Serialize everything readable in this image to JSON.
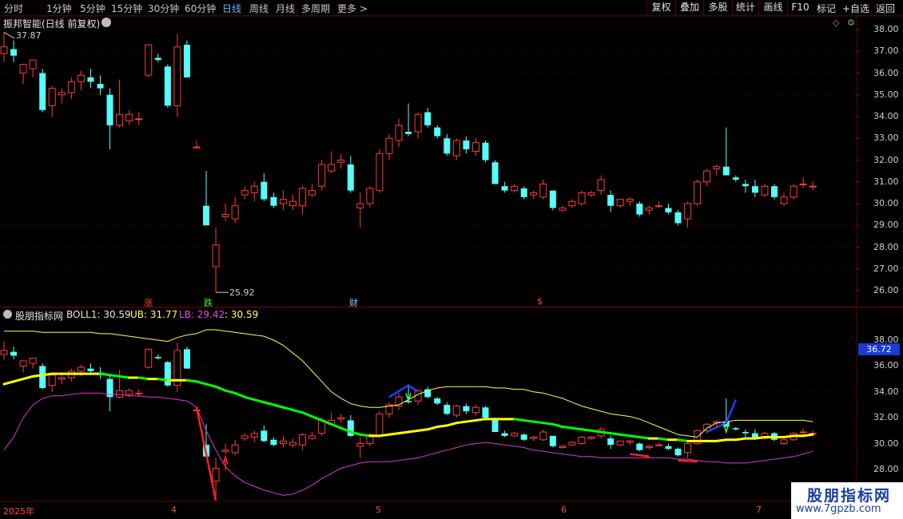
{
  "toolbar": {
    "periods": [
      "分时",
      "1分钟",
      "5分钟",
      "15分钟",
      "30分钟",
      "60分钟",
      "日线",
      "周线",
      "月线",
      "多周期",
      "更多 >"
    ],
    "actions": [
      "复权",
      "叠加",
      "多股",
      "统计",
      "画线",
      "F10",
      "+自选",
      "返回"
    ]
  },
  "main_chart": {
    "title": "振邦智能(日线 前复权)",
    "high_label": "37.87",
    "low_label": "25.92",
    "y_ticks": [
      "38.00",
      "37.00",
      "36.00",
      "35.00",
      "34.00",
      "33.00",
      "32.00",
      "31.00",
      "30.00",
      "29.00",
      "28.00",
      "27.00",
      "26.00"
    ],
    "markers": [
      "涨",
      "跌",
      "财",
      "$"
    ]
  },
  "indicator": {
    "name": "股朋指标网",
    "boll1_label": "BOLL1: 30.59",
    "ub_label": "UB: 31.77",
    "lb_label": "LB: 29.42",
    "extra_label": ": 30.59",
    "y_ticks": [
      "38.00",
      "36.00",
      "34.00",
      "32.00",
      "30.00",
      "28.00"
    ],
    "price_tag": "36.72"
  },
  "x_axis": {
    "labels": [
      "2025年",
      "4",
      "5",
      "6",
      "7"
    ]
  },
  "watermark": {
    "name": "股朋指标网",
    "url": "www.7gpzb.com"
  },
  "colors": {
    "up": "#ff3b3b",
    "down": "#54ffff",
    "upper_band": "#ffff55",
    "lower_band": "#d63ad6",
    "mid_up": "#ffff00",
    "mid_down": "#00ff00",
    "grid": "#5a0000"
  },
  "chart_data": {
    "type": "candlestick",
    "note_units": "price",
    "candles": [
      {
        "o": 36.9,
        "h": 37.87,
        "l": 36.5,
        "c": 37.2
      },
      {
        "o": 37.1,
        "h": 37.5,
        "l": 36.5,
        "c": 36.8
      },
      {
        "o": 36.0,
        "h": 36.4,
        "l": 35.5,
        "c": 36.4
      },
      {
        "o": 36.2,
        "h": 36.6,
        "l": 35.8,
        "c": 36.6
      },
      {
        "o": 36.0,
        "h": 36.2,
        "l": 34.2,
        "c": 34.3
      },
      {
        "o": 34.5,
        "h": 35.4,
        "l": 34.0,
        "c": 35.3
      },
      {
        "o": 35.0,
        "h": 35.3,
        "l": 34.6,
        "c": 35.1
      },
      {
        "o": 35.1,
        "h": 35.8,
        "l": 34.8,
        "c": 35.6
      },
      {
        "o": 35.6,
        "h": 36.1,
        "l": 35.2,
        "c": 35.9
      },
      {
        "o": 35.8,
        "h": 36.2,
        "l": 35.3,
        "c": 35.6
      },
      {
        "o": 35.5,
        "h": 35.9,
        "l": 35.0,
        "c": 35.3
      },
      {
        "o": 35.0,
        "h": 35.3,
        "l": 32.5,
        "c": 33.6
      },
      {
        "o": 33.6,
        "h": 35.7,
        "l": 33.5,
        "c": 34.1
      },
      {
        "o": 33.8,
        "h": 34.3,
        "l": 33.6,
        "c": 34.1
      },
      {
        "o": 33.9,
        "h": 34.2,
        "l": 33.6,
        "c": 33.9
      },
      {
        "o": 35.9,
        "h": 37.3,
        "l": 35.8,
        "c": 37.3
      },
      {
        "o": 36.7,
        "h": 36.9,
        "l": 36.5,
        "c": 36.6
      },
      {
        "o": 36.3,
        "h": 36.4,
        "l": 34.4,
        "c": 34.5
      },
      {
        "o": 34.5,
        "h": 37.8,
        "l": 34.0,
        "c": 37.2
      },
      {
        "o": 37.3,
        "h": 37.5,
        "l": 35.8,
        "c": 35.8
      },
      {
        "o": 32.6,
        "h": 32.9,
        "l": 32.6,
        "c": 32.6
      },
      {
        "o": 29.9,
        "h": 31.5,
        "l": 29.0,
        "c": 29.0
      },
      {
        "o": 27.1,
        "h": 28.9,
        "l": 25.92,
        "c": 28.1
      },
      {
        "o": 29.4,
        "h": 30.0,
        "l": 29.2,
        "c": 29.5
      },
      {
        "o": 29.3,
        "h": 30.3,
        "l": 29.1,
        "c": 29.9
      },
      {
        "o": 30.4,
        "h": 30.8,
        "l": 30.2,
        "c": 30.6
      },
      {
        "o": 30.5,
        "h": 31.0,
        "l": 30.1,
        "c": 30.8
      },
      {
        "o": 31.0,
        "h": 31.4,
        "l": 30.1,
        "c": 30.2
      },
      {
        "o": 30.3,
        "h": 30.5,
        "l": 29.8,
        "c": 29.9
      },
      {
        "o": 30.0,
        "h": 30.6,
        "l": 29.7,
        "c": 30.2
      },
      {
        "o": 29.9,
        "h": 30.4,
        "l": 29.7,
        "c": 30.1
      },
      {
        "o": 29.9,
        "h": 30.8,
        "l": 29.5,
        "c": 30.7
      },
      {
        "o": 30.4,
        "h": 30.9,
        "l": 30.3,
        "c": 30.6
      },
      {
        "o": 30.8,
        "h": 32.0,
        "l": 30.6,
        "c": 31.8
      },
      {
        "o": 31.5,
        "h": 32.4,
        "l": 31.4,
        "c": 31.8
      },
      {
        "o": 31.9,
        "h": 32.3,
        "l": 31.6,
        "c": 32.0
      },
      {
        "o": 31.8,
        "h": 32.2,
        "l": 30.5,
        "c": 30.6
      },
      {
        "o": 29.8,
        "h": 30.5,
        "l": 28.9,
        "c": 30.0
      },
      {
        "o": 30.0,
        "h": 30.8,
        "l": 29.8,
        "c": 30.7
      },
      {
        "o": 30.6,
        "h": 32.5,
        "l": 30.5,
        "c": 32.3
      },
      {
        "o": 32.3,
        "h": 33.2,
        "l": 32.0,
        "c": 33.0
      },
      {
        "o": 32.9,
        "h": 33.9,
        "l": 32.6,
        "c": 33.6
      },
      {
        "o": 33.3,
        "h": 34.6,
        "l": 33.1,
        "c": 33.2
      },
      {
        "o": 33.3,
        "h": 34.2,
        "l": 33.0,
        "c": 34.1
      },
      {
        "o": 34.2,
        "h": 34.4,
        "l": 33.5,
        "c": 33.6
      },
      {
        "o": 33.5,
        "h": 33.6,
        "l": 33.0,
        "c": 33.1
      },
      {
        "o": 33.0,
        "h": 33.2,
        "l": 32.2,
        "c": 32.3
      },
      {
        "o": 32.2,
        "h": 33.0,
        "l": 32.0,
        "c": 32.9
      },
      {
        "o": 32.9,
        "h": 33.1,
        "l": 32.3,
        "c": 32.5
      },
      {
        "o": 32.4,
        "h": 33.0,
        "l": 32.2,
        "c": 32.8
      },
      {
        "o": 32.8,
        "h": 32.9,
        "l": 31.9,
        "c": 32.0
      },
      {
        "o": 31.9,
        "h": 32.0,
        "l": 30.9,
        "c": 30.9
      },
      {
        "o": 30.8,
        "h": 31.0,
        "l": 30.5,
        "c": 30.6
      },
      {
        "o": 30.6,
        "h": 30.9,
        "l": 30.5,
        "c": 30.8
      },
      {
        "o": 30.7,
        "h": 30.8,
        "l": 30.2,
        "c": 30.3
      },
      {
        "o": 30.4,
        "h": 30.6,
        "l": 30.2,
        "c": 30.5
      },
      {
        "o": 30.3,
        "h": 31.1,
        "l": 30.2,
        "c": 30.9
      },
      {
        "o": 30.6,
        "h": 30.6,
        "l": 29.7,
        "c": 29.8
      },
      {
        "o": 29.7,
        "h": 29.9,
        "l": 29.6,
        "c": 29.8
      },
      {
        "o": 29.9,
        "h": 30.2,
        "l": 29.8,
        "c": 30.1
      },
      {
        "o": 30.0,
        "h": 30.6,
        "l": 29.9,
        "c": 30.5
      },
      {
        "o": 30.4,
        "h": 30.6,
        "l": 30.3,
        "c": 30.5
      },
      {
        "o": 30.6,
        "h": 31.3,
        "l": 30.4,
        "c": 31.1
      },
      {
        "o": 30.4,
        "h": 30.6,
        "l": 29.6,
        "c": 29.9
      },
      {
        "o": 29.9,
        "h": 30.2,
        "l": 29.8,
        "c": 30.2
      },
      {
        "o": 30.1,
        "h": 30.3,
        "l": 29.9,
        "c": 30.2
      },
      {
        "o": 30.0,
        "h": 30.1,
        "l": 29.4,
        "c": 29.5
      },
      {
        "o": 29.7,
        "h": 29.9,
        "l": 29.5,
        "c": 29.8
      },
      {
        "o": 29.9,
        "h": 30.1,
        "l": 29.8,
        "c": 29.9
      },
      {
        "o": 29.8,
        "h": 30.0,
        "l": 29.5,
        "c": 29.6
      },
      {
        "o": 29.6,
        "h": 29.7,
        "l": 29.0,
        "c": 29.1
      },
      {
        "o": 29.3,
        "h": 30.1,
        "l": 28.9,
        "c": 30.0
      },
      {
        "o": 30.0,
        "h": 31.1,
        "l": 29.9,
        "c": 31.0
      },
      {
        "o": 31.0,
        "h": 31.6,
        "l": 30.8,
        "c": 31.5
      },
      {
        "o": 31.6,
        "h": 31.8,
        "l": 31.3,
        "c": 31.7
      },
      {
        "o": 31.7,
        "h": 33.5,
        "l": 31.3,
        "c": 31.3
      },
      {
        "o": 31.2,
        "h": 31.3,
        "l": 31.0,
        "c": 31.1
      },
      {
        "o": 30.9,
        "h": 31.1,
        "l": 30.5,
        "c": 30.8
      },
      {
        "o": 30.8,
        "h": 31.1,
        "l": 30.3,
        "c": 30.5
      },
      {
        "o": 30.4,
        "h": 30.9,
        "l": 30.3,
        "c": 30.8
      },
      {
        "o": 30.8,
        "h": 30.9,
        "l": 30.2,
        "c": 30.3
      },
      {
        "o": 30.0,
        "h": 30.5,
        "l": 29.9,
        "c": 30.3
      },
      {
        "o": 30.3,
        "h": 30.9,
        "l": 30.2,
        "c": 30.8
      },
      {
        "o": 30.9,
        "h": 31.2,
        "l": 30.7,
        "c": 30.9
      },
      {
        "o": 30.8,
        "h": 31.0,
        "l": 30.6,
        "c": 30.8
      }
    ],
    "boll_mid": [
      34.6,
      34.8,
      35.0,
      35.2,
      35.3,
      35.4,
      35.4,
      35.4,
      35.4,
      35.4,
      35.4,
      35.3,
      35.2,
      35.1,
      35.1,
      35.0,
      35.0,
      34.9,
      34.9,
      34.9,
      34.8,
      34.6,
      34.4,
      34.1,
      33.9,
      33.6,
      33.4,
      33.2,
      33.0,
      32.8,
      32.6,
      32.4,
      32.1,
      31.8,
      31.5,
      31.2,
      30.9,
      30.7,
      30.6,
      30.6,
      30.7,
      30.8,
      30.9,
      31.0,
      31.1,
      31.3,
      31.4,
      31.6,
      31.7,
      31.8,
      31.9,
      31.9,
      31.9,
      31.9,
      31.8,
      31.7,
      31.6,
      31.5,
      31.3,
      31.2,
      31.1,
      31.0,
      30.9,
      30.8,
      30.7,
      30.6,
      30.5,
      30.4,
      30.4,
      30.3,
      30.3,
      30.2,
      30.2,
      30.2,
      30.2,
      30.3,
      30.3,
      30.4,
      30.4,
      30.5,
      30.5,
      30.5,
      30.6,
      30.6,
      30.7
    ],
    "boll_upper": [
      38.7,
      38.7,
      38.7,
      38.7,
      38.6,
      38.6,
      38.6,
      38.6,
      38.6,
      38.6,
      38.5,
      38.5,
      38.4,
      38.3,
      38.2,
      38.1,
      38.0,
      37.9,
      38.2,
      38.4,
      38.5,
      38.8,
      38.8,
      38.7,
      38.6,
      38.5,
      38.4,
      38.3,
      38.0,
      37.6,
      37.0,
      36.4,
      35.6,
      34.8,
      34.0,
      33.5,
      33.1,
      32.9,
      32.8,
      32.8,
      32.9,
      33.0,
      33.4,
      33.8,
      34.1,
      34.3,
      34.4,
      34.4,
      34.4,
      34.4,
      34.4,
      34.3,
      34.3,
      34.2,
      34.2,
      34.0,
      33.9,
      33.7,
      33.5,
      33.2,
      32.9,
      32.7,
      32.5,
      32.3,
      32.2,
      32.1,
      31.9,
      31.6,
      31.3,
      31.0,
      30.7,
      30.6,
      30.5,
      31.2,
      31.6,
      31.7,
      31.8,
      31.8,
      31.8,
      31.8,
      31.8,
      31.8,
      31.8,
      31.8,
      31.7
    ],
    "boll_lower": [
      29.5,
      30.5,
      32.0,
      33.0,
      33.5,
      33.7,
      33.7,
      33.8,
      33.9,
      33.9,
      33.9,
      33.8,
      33.8,
      33.7,
      33.7,
      33.6,
      33.6,
      33.5,
      33.4,
      33.3,
      32.8,
      31.0,
      29.5,
      28.2,
      27.5,
      27.0,
      26.7,
      26.4,
      26.2,
      26.0,
      26.1,
      26.4,
      26.8,
      27.3,
      27.7,
      28.1,
      28.3,
      28.5,
      28.6,
      28.6,
      28.6,
      28.7,
      28.8,
      28.9,
      29.1,
      29.3,
      29.5,
      29.7,
      29.9,
      30.0,
      30.1,
      30.0,
      29.9,
      29.8,
      29.7,
      29.5,
      29.4,
      29.3,
      29.2,
      29.1,
      29.0,
      29.0,
      28.9,
      28.9,
      28.9,
      28.9,
      28.9,
      28.9,
      28.9,
      28.9,
      28.8,
      28.8,
      28.7,
      28.6,
      28.6,
      28.5,
      28.5,
      28.5,
      28.6,
      28.7,
      28.8,
      28.9,
      29.0,
      29.2,
      29.4
    ]
  }
}
